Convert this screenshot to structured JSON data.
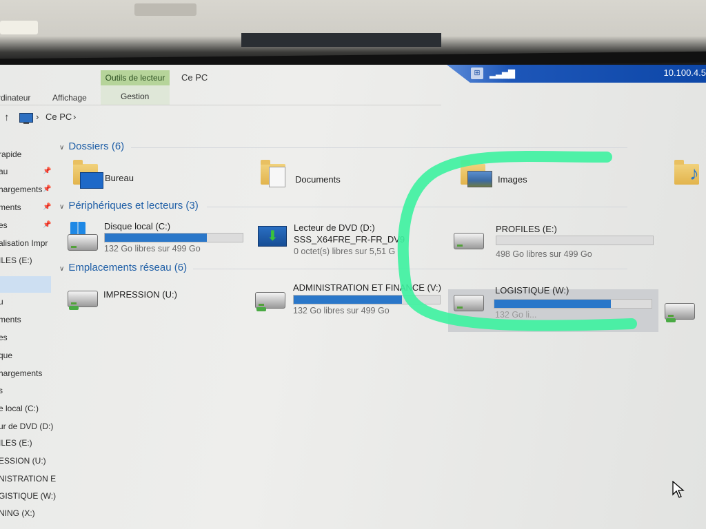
{
  "ribbon": {
    "tab_computer": "rdinateur",
    "tab_view": "Affichage",
    "context_tab": "Outils de lecteur",
    "context_sub": "Gestion",
    "window_title": "Ce PC"
  },
  "remote": {
    "host": "10.100.4.5"
  },
  "address": {
    "crumb1": "Ce PC",
    "sep1": "›",
    "sep0": "›"
  },
  "nav": {
    "items": [
      "rapide",
      "au",
      "hargements",
      "ments",
      "es",
      "alisation Impr",
      "ILES (E:)",
      "",
      "u",
      "ments",
      "es",
      "que",
      "hargements",
      "s",
      "e local (C:)",
      "ur de DVD (D:)",
      "ILES (E:)",
      "ESSION (U:)",
      "NISTRATION E",
      "GISTIQUE (W:)",
      "NING (X:)"
    ]
  },
  "sections": {
    "folders": "Dossiers (6)",
    "devices": "Périphériques et lecteurs (3)",
    "network": "Emplacements réseau (6)"
  },
  "folders": [
    {
      "name": "Bureau"
    },
    {
      "name": "Documents"
    },
    {
      "name": "Images"
    }
  ],
  "devices": [
    {
      "name": "Disque local (C:)",
      "free": "132 Go libres sur 499 Go",
      "used_fraction": 0.74
    },
    {
      "name": "Lecteur de DVD (D:)",
      "label": "SSS_X64FRE_FR-FR_DV9",
      "free": "0 octet(s) libres sur 5,51 G"
    },
    {
      "name": "PROFILES (E:)",
      "free": "498 Go libres sur 499 Go",
      "used_fraction": 0.0
    }
  ],
  "network": [
    {
      "name": "IMPRESSION (U:)"
    },
    {
      "name": "ADMINISTRATION ET FINANCE (V:)",
      "free": "132 Go libres sur 499 Go",
      "used_fraction": 0.74
    },
    {
      "name": "LOGISTIQUE (W:)",
      "free": "132 Go li...",
      "used_fraction": 0.74
    }
  ],
  "colors": {
    "accent_blue": "#2a77c9",
    "section_blue": "#1e5ea6",
    "context_tab": "#b6d49a",
    "marker": "#3df2a0"
  }
}
